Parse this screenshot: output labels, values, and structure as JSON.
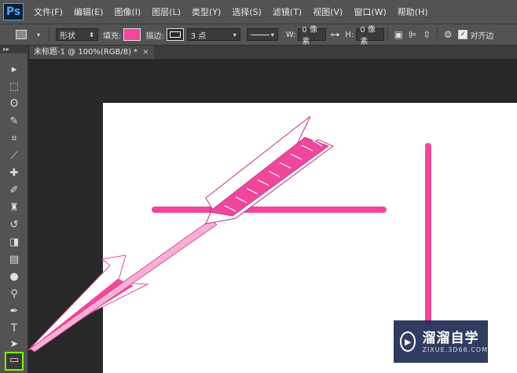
{
  "app": {
    "logo": "Ps"
  },
  "menu": [
    "文件(F)",
    "编辑(E)",
    "图像(I)",
    "图层(L)",
    "类型(Y)",
    "选择(S)",
    "滤镜(T)",
    "视图(V)",
    "窗口(W)",
    "帮助(H)"
  ],
  "options": {
    "tool_mode": "形状",
    "fill_label": "填充:",
    "fill_color": "#f0479c",
    "stroke_label": "描边:",
    "stroke_width": "3 点",
    "w_label": "W:",
    "w_value": "0 像素",
    "h_label": "H:",
    "h_value": "0 像素",
    "align_edges_label": "对齐边"
  },
  "document": {
    "tab_title": "未标题-1 @ 100%(RGB/8) *",
    "close_glyph": "×"
  },
  "toolbox": {
    "collapse_glyph": "▸▸",
    "tools": [
      "move-tool",
      "marquee-tool",
      "lasso-tool",
      "quick-select-tool",
      "crop-tool",
      "eyedropper-tool",
      "healing-tool",
      "brush-tool",
      "stamp-tool",
      "history-brush-tool",
      "eraser-tool",
      "gradient-tool",
      "blur-tool",
      "dodge-tool",
      "pen-tool",
      "type-tool",
      "path-select-tool",
      "rectangle-tool"
    ],
    "active_tool": "rectangle-tool"
  },
  "colors": {
    "accent_pink": "#f0479c",
    "active_tool_outline": "#7cfc00",
    "ui_gray": "#535353"
  },
  "watermark": {
    "title": "溜溜自学",
    "subtitle": "ZIXUE.3D66.COM"
  }
}
